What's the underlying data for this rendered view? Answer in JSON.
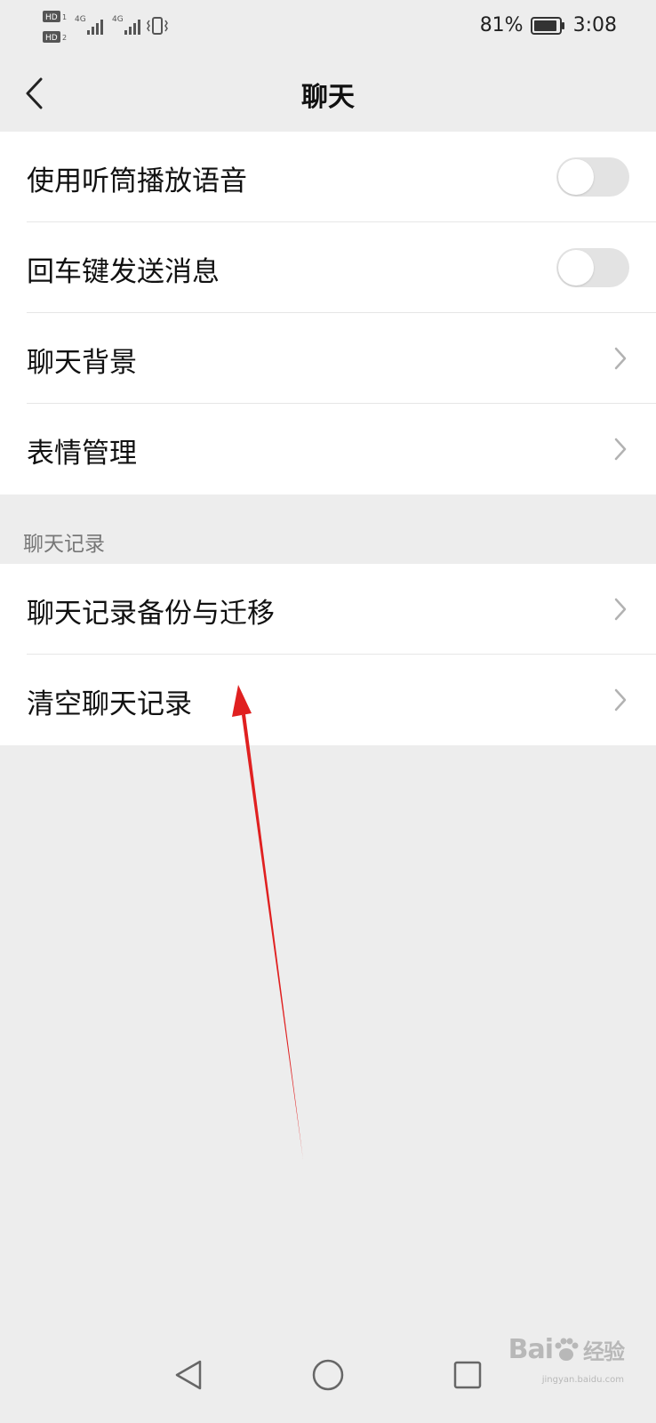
{
  "status_bar": {
    "network_1": "4G",
    "network_2": "4G",
    "battery_percent": "81%",
    "time": "3:08",
    "hd_1": "HD",
    "hd_2": "HD"
  },
  "header": {
    "title": "聊天"
  },
  "general_settings": {
    "items": [
      {
        "label": "使用听筒播放语音",
        "type": "toggle",
        "on": false
      },
      {
        "label": "回车键发送消息",
        "type": "toggle",
        "on": false
      },
      {
        "label": "聊天背景",
        "type": "link"
      },
      {
        "label": "表情管理",
        "type": "link"
      }
    ]
  },
  "chat_history": {
    "section_title": "聊天记录",
    "items": [
      {
        "label": "聊天记录备份与迁移",
        "type": "link"
      },
      {
        "label": "清空聊天记录",
        "type": "link"
      }
    ]
  },
  "annotation": {
    "arrow_color": "#e02020"
  },
  "watermark": {
    "brand": "Bai",
    "brand_suffix": "经验",
    "subtitle": "jingyan.baidu.com"
  },
  "colors": {
    "background": "#ededed",
    "card": "#ffffff",
    "toggle_off": "#e3e3e3",
    "chevron": "#b2b2b2"
  }
}
